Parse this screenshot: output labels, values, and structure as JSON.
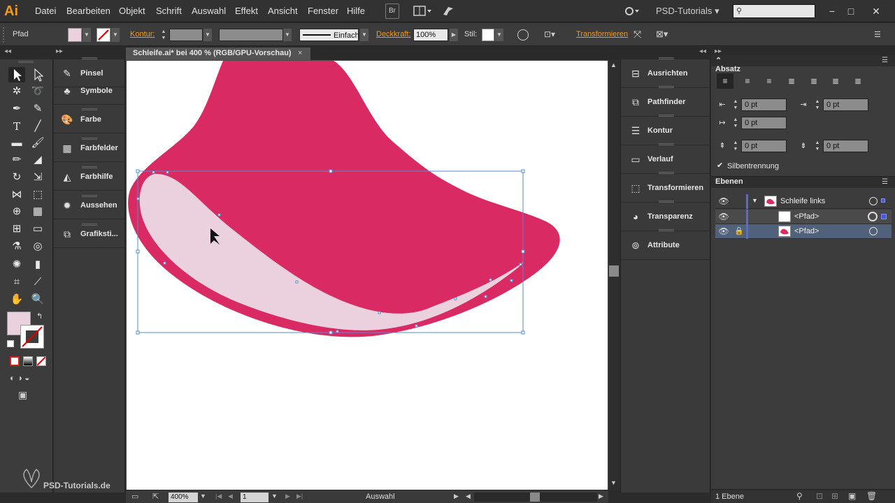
{
  "app": {
    "logo": "Ai",
    "workspace": "PSD-Tutorials"
  },
  "menu": [
    "Datei",
    "Bearbeiten",
    "Objekt",
    "Schrift",
    "Auswahl",
    "Effekt",
    "Ansicht",
    "Fenster",
    "Hilfe"
  ],
  "menubar_buttons": {
    "bridge": "Br"
  },
  "search": {
    "value": "",
    "placeholder": ""
  },
  "control": {
    "object_type": "Pfad",
    "stroke_label": "Kontur:",
    "stroke_profile": "Einfach",
    "opacity_label": "Deckkraft:",
    "opacity_value": "100%",
    "style_label": "Stil:",
    "transform_label": "Transformieren"
  },
  "document": {
    "tab_title": "Schleife.ai* bei 400 % (RGB/GPU-Vorschau)"
  },
  "left_dock": [
    "Pinsel",
    "Symbole",
    "Farbe",
    "Farbfelder",
    "Farbhilfe",
    "Aussehen",
    "Grafiksti..."
  ],
  "right_dock": [
    "Ausrichten",
    "Pathfinder",
    "Kontur",
    "Verlauf",
    "Transformieren",
    "Transparenz",
    "Attribute"
  ],
  "absatz": {
    "title": "Absatz",
    "left_indent": "0 pt",
    "right_indent": "0 pt",
    "first_line_indent": "0 pt",
    "space_before": "0 pt",
    "space_after": "0 pt",
    "hyphenation": "Silbentrennung"
  },
  "ebenen": {
    "title": "Ebenen",
    "layers": [
      {
        "name": "Schleife links"
      },
      {
        "name": "<Pfad>"
      },
      {
        "name": "<Pfad>"
      }
    ],
    "count": "1 Ebene"
  },
  "status": {
    "zoom": "400%",
    "artboard": "1",
    "tool": "Auswahl"
  },
  "watermark": "PSD-Tutorials.de",
  "colors": {
    "ui_bg": "#3c3c3c",
    "accent": "#f29a1f",
    "ribbon_pink": "#d92a64",
    "ribbon_light": "#ebd1de",
    "selection": "#4d8fd6"
  }
}
